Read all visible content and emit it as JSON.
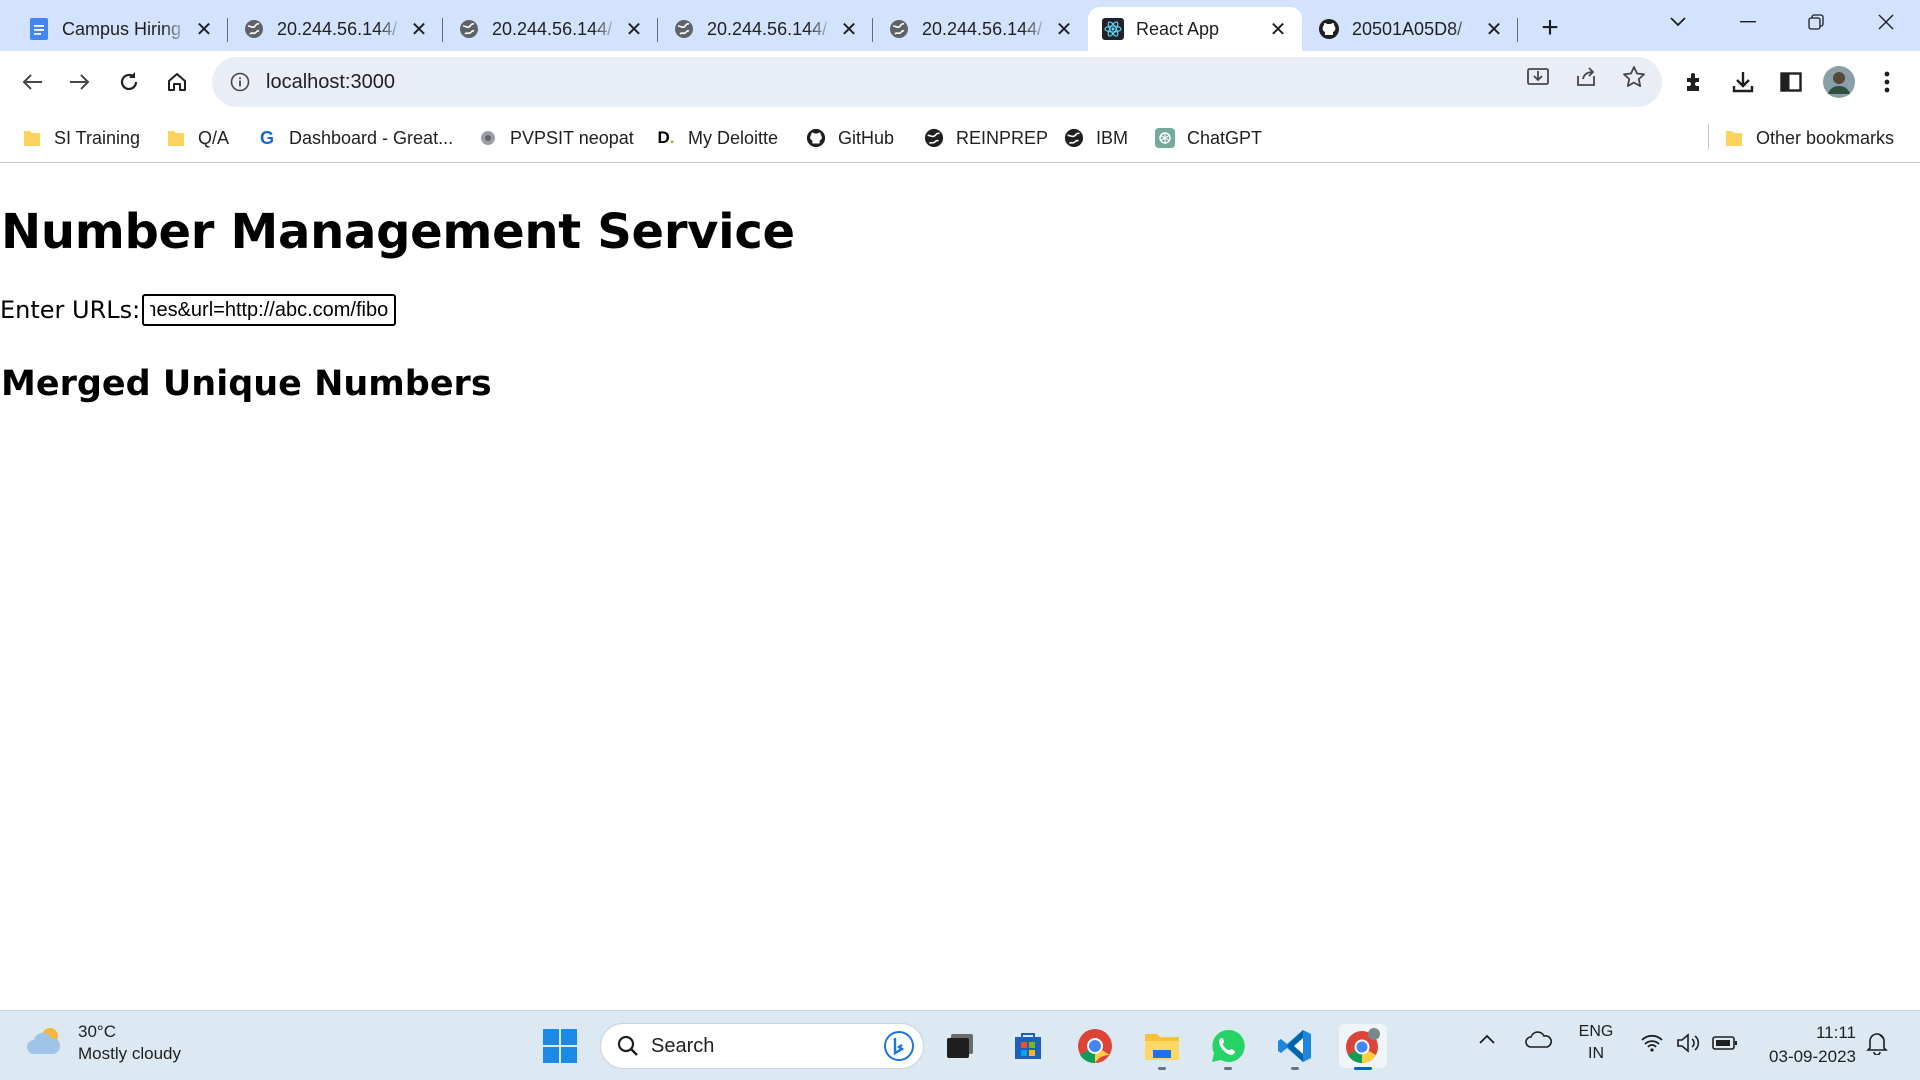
{
  "browser": {
    "tabs": [
      {
        "title": "Campus Hiring",
        "favicon": "docs-icon"
      },
      {
        "title": "20.244.56.144/",
        "favicon": "globe-icon"
      },
      {
        "title": "20.244.56.144/",
        "favicon": "globe-icon"
      },
      {
        "title": "20.244.56.144/",
        "favicon": "globe-icon"
      },
      {
        "title": "20.244.56.144/",
        "favicon": "globe-icon"
      },
      {
        "title": "React App",
        "favicon": "react-icon",
        "active": true
      },
      {
        "title": "20501A05D8/",
        "favicon": "github-icon"
      }
    ],
    "address": "localhost:3000",
    "bookmarks": [
      {
        "label": "SI Training",
        "icon": "folder-icon"
      },
      {
        "label": "Q/A",
        "icon": "folder-icon"
      },
      {
        "label": "Dashboard - Great...",
        "icon": "greatlearning-icon"
      },
      {
        "label": "PVPSIT neopat",
        "icon": "neopat-icon"
      },
      {
        "label": "My Deloitte",
        "icon": "deloitte-icon"
      },
      {
        "label": "GitHub",
        "icon": "github-icon"
      },
      {
        "label": "REINPREP",
        "icon": "globe-icon"
      },
      {
        "label": "IBM",
        "icon": "globe-icon"
      },
      {
        "label": "ChatGPT",
        "icon": "chatgpt-icon"
      }
    ],
    "other_bookmarks": "Other bookmarks"
  },
  "page": {
    "heading": "Number Management Service",
    "url_label": "Enter URLs:",
    "url_value": "http://abc.com/primes&url=http://abc.com/fibo",
    "subheading": "Merged Unique Numbers"
  },
  "taskbar": {
    "weather_temp": "30°C",
    "weather_desc": "Mostly cloudy",
    "search_placeholder": "Search",
    "lang_top": "ENG",
    "lang_bottom": "IN",
    "time": "11:11",
    "date": "03-09-2023"
  },
  "colors": {
    "tabstrip": "#d3e3fd",
    "omnibox": "#e9eef6",
    "taskbar": "#dde9f2",
    "accent": "#0067c0"
  }
}
